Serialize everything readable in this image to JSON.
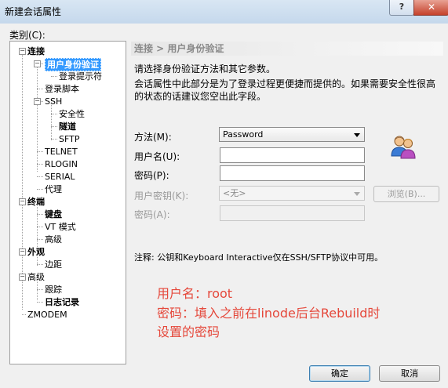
{
  "window": {
    "title": "新建会话属性",
    "help_label": "?",
    "close_label": "✕"
  },
  "category_label": "类别(C):",
  "tree": [
    {
      "label": "连接",
      "bold": true,
      "expander": "−",
      "selected": false
    },
    {
      "label": "用户身份验证",
      "bold": true,
      "expander": "−",
      "selected": true
    },
    {
      "label": "登录提示符",
      "bold": false,
      "expander": "",
      "selected": false
    },
    {
      "label": "登录脚本",
      "bold": false,
      "expander": "",
      "selected": false
    },
    {
      "label": "SSH",
      "bold": false,
      "expander": "−",
      "selected": false
    },
    {
      "label": "安全性",
      "bold": false,
      "expander": "",
      "selected": false
    },
    {
      "label": "隧道",
      "bold": true,
      "expander": "",
      "selected": false
    },
    {
      "label": "SFTP",
      "bold": false,
      "expander": "",
      "selected": false
    },
    {
      "label": "TELNET",
      "bold": false,
      "expander": "",
      "selected": false
    },
    {
      "label": "RLOGIN",
      "bold": false,
      "expander": "",
      "selected": false
    },
    {
      "label": "SERIAL",
      "bold": false,
      "expander": "",
      "selected": false
    },
    {
      "label": "代理",
      "bold": false,
      "expander": "",
      "selected": false
    },
    {
      "label": "终端",
      "bold": true,
      "expander": "−",
      "selected": false
    },
    {
      "label": "键盘",
      "bold": true,
      "expander": "",
      "selected": false
    },
    {
      "label": "VT 模式",
      "bold": false,
      "expander": "",
      "selected": false
    },
    {
      "label": "高级",
      "bold": false,
      "expander": "",
      "selected": false
    },
    {
      "label": "外观",
      "bold": true,
      "expander": "−",
      "selected": false
    },
    {
      "label": "边距",
      "bold": false,
      "expander": "",
      "selected": false
    },
    {
      "label": "高级",
      "bold": false,
      "expander": "−",
      "selected": false
    },
    {
      "label": "跟踪",
      "bold": false,
      "expander": "",
      "selected": false
    },
    {
      "label": "日志记录",
      "bold": true,
      "expander": "",
      "selected": false
    },
    {
      "label": "ZMODEM",
      "bold": false,
      "expander": "",
      "selected": false
    }
  ],
  "panel": {
    "breadcrumb": "连接 > 用户身份验证",
    "description_1": "请选择身份验证方法和其它参数。",
    "description_2": "会话属性中此部分是为了登录过程更便捷而提供的。如果需要安全性很高",
    "description_3": "的状态的话建议您空出此字段。",
    "method_label": "方法(M):",
    "method_value": "Password",
    "username_label": "用户名(U):",
    "username_value": "",
    "password_label": "密码(P):",
    "password_value": "",
    "userkey_label": "用户密钥(K):",
    "userkey_value": "<无>",
    "browse_label": "浏览(B)...",
    "passphrase_label": "密码(A):",
    "passphrase_value": "",
    "note": "注释: 公钥和Keyboard Interactive仅在SSH/SFTP协议中可用。",
    "user_icon": "users-icon"
  },
  "annotation": {
    "line_1": "用户名：root",
    "line_2": "密码：填入之前在linode后台Rebuild时",
    "line_3": "设置的密码"
  },
  "buttons": {
    "ok_label": "确定",
    "cancel_label": "取消"
  },
  "colors": {
    "selection": "#3399ff",
    "annotation": "#e5483b",
    "accent": "#3c7fb1"
  }
}
